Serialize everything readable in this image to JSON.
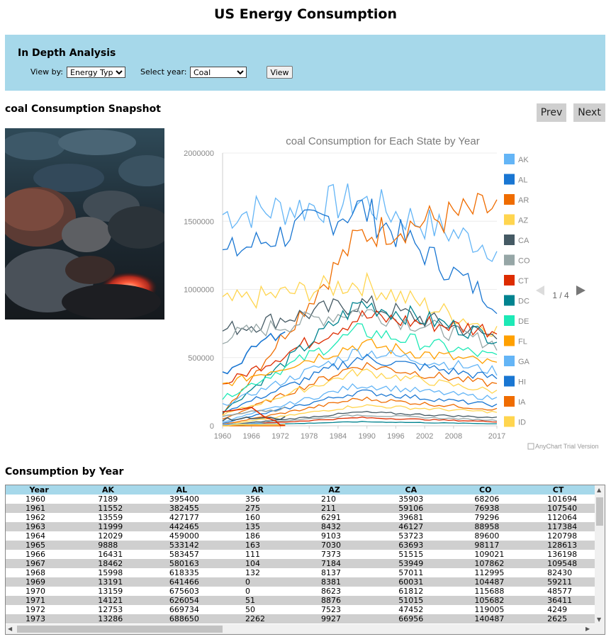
{
  "page": {
    "title": "US Energy Consumption"
  },
  "analysis": {
    "heading": "In Depth Analysis",
    "view_by_label": "View by:",
    "view_by_value": "Energy Type",
    "year_label": "Select year:",
    "year_value": "Coal",
    "view_button": "View"
  },
  "snapshot": {
    "title": "coal Consumption Snapshot",
    "prev_label": "Prev",
    "next_label": "Next",
    "image_icon": "glowing-coal-photo"
  },
  "chart_data": {
    "type": "line",
    "title": "coal Consumption for Each State by Year",
    "xlabel": "",
    "ylabel": "",
    "x_ticks": [
      "1960",
      "1966",
      "1972",
      "1978",
      "1984",
      "1990",
      "1996",
      "2002",
      "2008",
      "2017"
    ],
    "y_ticks": [
      "0",
      "500000",
      "1000000",
      "1500000",
      "2000000"
    ],
    "ylim": [
      0,
      2000000
    ],
    "legend": [
      "AK",
      "AL",
      "AR",
      "AZ",
      "CA",
      "CO",
      "CT",
      "DC",
      "DE",
      "FL",
      "GA",
      "HI",
      "IA",
      "ID"
    ],
    "legend_colors": [
      "#64b5f6",
      "#1976d2",
      "#ef6c00",
      "#ffd54f",
      "#455a64",
      "#96a6a6",
      "#dd2c00",
      "#00838f",
      "#1de9b6",
      "#ffa000",
      "#64b5f6",
      "#1976d2",
      "#ef6c00",
      "#ffd54f"
    ],
    "legend_page": "1 / 4",
    "credits": "AnyChart Trial Version",
    "series": [
      {
        "name": "AK",
        "values": [
          7189,
          11552,
          13559,
          11999,
          12029,
          9888,
          16431,
          18462,
          15998,
          13191,
          13159,
          14121,
          12753,
          13286
        ]
      },
      {
        "name": "AL",
        "values": [
          395400,
          382455,
          427177,
          442465,
          459000,
          533142,
          583457,
          580163,
          618335,
          641466,
          675603,
          626054,
          669734,
          688650
        ]
      },
      {
        "name": "AR",
        "values": [
          356,
          275,
          160,
          135,
          186,
          163,
          111,
          104,
          132,
          0,
          0,
          51,
          50,
          2262
        ]
      },
      {
        "name": "AZ",
        "values": [
          210,
          211,
          6291,
          8432,
          9103,
          7030,
          7373,
          7184,
          8137,
          8381,
          8623,
          8876,
          7523,
          9927
        ]
      },
      {
        "name": "CA",
        "values": [
          35903,
          59106,
          39681,
          46127,
          53723,
          63693,
          51515,
          53949,
          57011,
          60031,
          61812,
          51015,
          47452,
          66956
        ]
      },
      {
        "name": "CO",
        "values": [
          68206,
          76938,
          79296,
          88958,
          89600,
          98117,
          109021,
          107862,
          112995,
          104487,
          115688,
          105682,
          119005,
          140487
        ]
      },
      {
        "name": "CT",
        "values": [
          101694,
          107540,
          112064,
          117384,
          120798,
          128613,
          136198,
          109548,
          82430,
          59211,
          48577,
          36411,
          4249,
          2625
        ]
      }
    ]
  },
  "table": {
    "title": "Consumption by Year",
    "headers": [
      "Year",
      "AK",
      "AL",
      "AR",
      "AZ",
      "CA",
      "CO",
      "CT"
    ],
    "rows": [
      [
        "1960",
        "7189",
        "395400",
        "356",
        "210",
        "35903",
        "68206",
        "101694"
      ],
      [
        "1961",
        "11552",
        "382455",
        "275",
        "211",
        "59106",
        "76938",
        "107540"
      ],
      [
        "1962",
        "13559",
        "427177",
        "160",
        "6291",
        "39681",
        "79296",
        "112064"
      ],
      [
        "1963",
        "11999",
        "442465",
        "135",
        "8432",
        "46127",
        "88958",
        "117384"
      ],
      [
        "1964",
        "12029",
        "459000",
        "186",
        "9103",
        "53723",
        "89600",
        "120798"
      ],
      [
        "1965",
        "9888",
        "533142",
        "163",
        "7030",
        "63693",
        "98117",
        "128613"
      ],
      [
        "1966",
        "16431",
        "583457",
        "111",
        "7373",
        "51515",
        "109021",
        "136198"
      ],
      [
        "1967",
        "18462",
        "580163",
        "104",
        "7184",
        "53949",
        "107862",
        "109548"
      ],
      [
        "1968",
        "15998",
        "618335",
        "132",
        "8137",
        "57011",
        "112995",
        "82430"
      ],
      [
        "1969",
        "13191",
        "641466",
        "0",
        "8381",
        "60031",
        "104487",
        "59211"
      ],
      [
        "1970",
        "13159",
        "675603",
        "0",
        "8623",
        "61812",
        "115688",
        "48577"
      ],
      [
        "1971",
        "14121",
        "626054",
        "51",
        "8876",
        "51015",
        "105682",
        "36411"
      ],
      [
        "1972",
        "12753",
        "669734",
        "50",
        "7523",
        "47452",
        "119005",
        "4249"
      ],
      [
        "1973",
        "13286",
        "688650",
        "2262",
        "9927",
        "66956",
        "140487",
        "2625"
      ]
    ]
  }
}
